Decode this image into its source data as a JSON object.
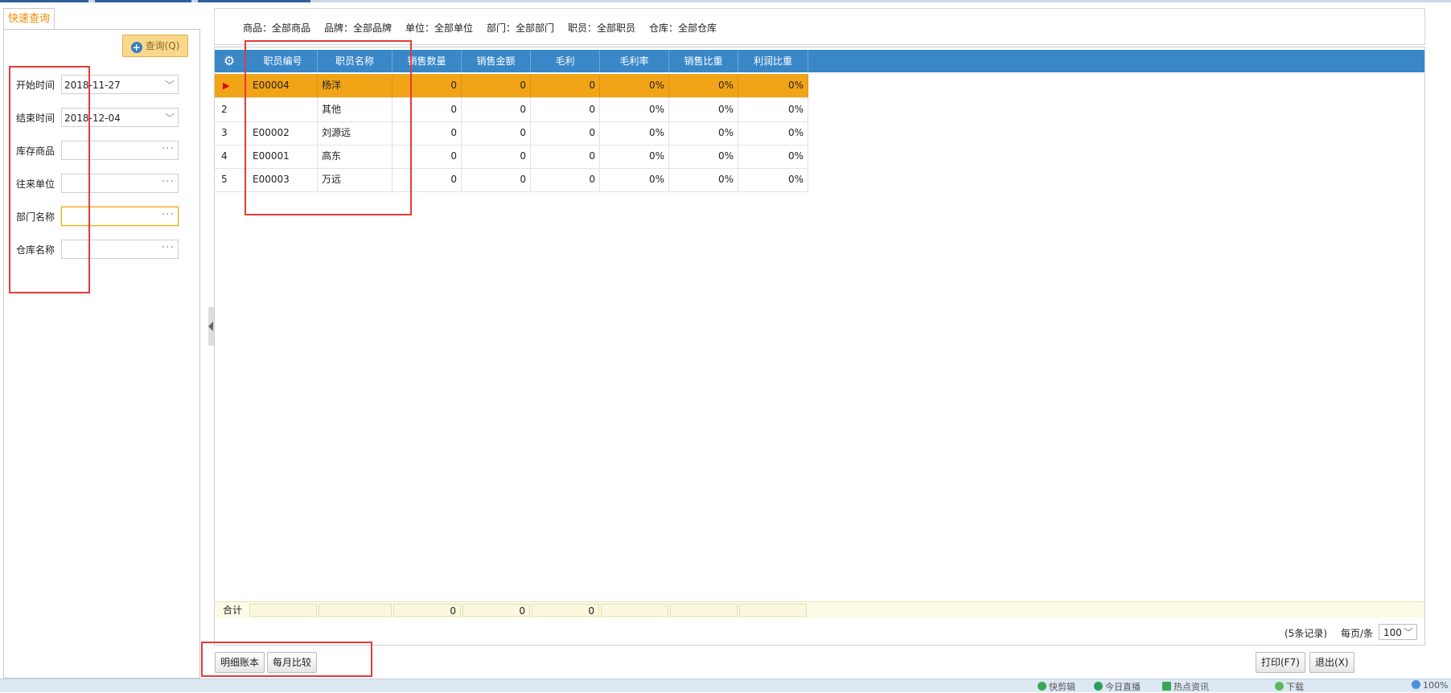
{
  "left_panel": {
    "tab_label": "快速查询",
    "query_button": "查询(Q)",
    "fields": [
      {
        "label": "开始时间",
        "value": "2018-11-27"
      },
      {
        "label": "结束时间",
        "value": "2018-12-04"
      },
      {
        "label": "库存商品",
        "value": ""
      },
      {
        "label": "往来单位",
        "value": ""
      },
      {
        "label": "部门名称",
        "value": ""
      },
      {
        "label": "仓库名称",
        "value": ""
      }
    ]
  },
  "filters": [
    "商品：全部商品",
    "品牌：全部品牌",
    "单位：全部单位",
    "部门：全部部门",
    "职员：全部职员",
    "仓库：全部仓库"
  ],
  "grid": {
    "columns": [
      "职员编号",
      "职员名称",
      "销售数量",
      "销售金额",
      "毛利",
      "毛利率",
      "销售比重",
      "利润比重"
    ],
    "rows": [
      {
        "n": "",
        "code": "E00004",
        "name": "杨洋",
        "qty": "0",
        "amount": "0",
        "profit": "0",
        "margin": "0%",
        "sales_ratio": "0%",
        "profit_ratio": "0%"
      },
      {
        "n": "2",
        "code": "",
        "name": "其他",
        "qty": "0",
        "amount": "0",
        "profit": "0",
        "margin": "0%",
        "sales_ratio": "0%",
        "profit_ratio": "0%"
      },
      {
        "n": "3",
        "code": "E00002",
        "name": "刘源远",
        "qty": "0",
        "amount": "0",
        "profit": "0",
        "margin": "0%",
        "sales_ratio": "0%",
        "profit_ratio": "0%"
      },
      {
        "n": "4",
        "code": "E00001",
        "name": "高东",
        "qty": "0",
        "amount": "0",
        "profit": "0",
        "margin": "0%",
        "sales_ratio": "0%",
        "profit_ratio": "0%"
      },
      {
        "n": "5",
        "code": "E00003",
        "name": "万远",
        "qty": "0",
        "amount": "0",
        "profit": "0",
        "margin": "0%",
        "sales_ratio": "0%",
        "profit_ratio": "0%"
      }
    ],
    "summary": {
      "label": "合计",
      "qty": "0",
      "amount": "0",
      "profit": "0"
    }
  },
  "pager": {
    "records": "(5条记录)",
    "per_page_label": "每页/条",
    "per_page": "100"
  },
  "buttons": {
    "detail": "明细账本",
    "monthly": "每月比较",
    "print": "打印(F7)",
    "exit": "退出(X)"
  },
  "taskbar": [
    "快剪辑",
    "今日直播",
    "热点资讯",
    "下载",
    "100%"
  ],
  "colors": {
    "header": "#3a87c8",
    "selected_row": "#f2a417",
    "accent_orange": "#f08b00",
    "annotation_red": "#e43b3b"
  }
}
